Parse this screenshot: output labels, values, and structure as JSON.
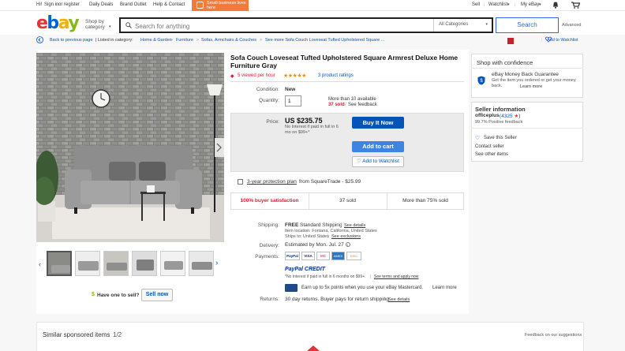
{
  "topbar": {
    "greeting": "Hi!",
    "sign_in": "Sign in",
    "or": "or",
    "register": "register",
    "daily_deals": "Daily Deals",
    "brand_outlet": "Brand Outlet",
    "help_contact": "Help & Contact",
    "promo_text": "Small business lives here",
    "sell": "Sell",
    "watchlist": "Watchlist",
    "my_ebay": "My eBay"
  },
  "header": {
    "logo": [
      "e",
      "b",
      "a",
      "y"
    ],
    "shop_by_category": "Shop by category",
    "search_placeholder": "Search for anything",
    "category_select": "All Categories",
    "search_button": "Search",
    "advanced": "Advanced"
  },
  "breadcrumb": {
    "back": "Back to previous page",
    "listed_in": "| Listed in category:",
    "items": [
      "Home & Garden",
      "Furniture",
      "Sofas, Armchairs & Couches",
      "See more Sofa Couch Loveseat Tufted Upholstered Square ..."
    ],
    "add_to_watchlist": "Add to Watchlist"
  },
  "listing": {
    "title": "Sofa Couch Loveseat Tufted Upholstered Square Armrest Deluxe Home Furniture Gray",
    "viewed": "5 viewed per hour",
    "ratings": "3 product ratings",
    "condition_label": "Condition:",
    "condition_value": "New",
    "quantity_label": "Quantity:",
    "quantity_value": "1",
    "available": "More than 10 available",
    "sold_link": "37 sold",
    "feedback_link": "See feedback",
    "price_label": "Price:",
    "price": "US $235.75",
    "interest": "No Interest if paid in full in 6 mo on $99+*",
    "buy_now": "Buy It Now",
    "add_to_cart": "Add to cart",
    "add_watchlist": "Add to Watchlist",
    "protection_link": "3-year protection plan",
    "protection_rest": "from SquareTrade - $25.99",
    "stat_satisfaction": "100% buyer satisfaction",
    "stat_sold": "37 sold",
    "stat_more": "More than 75% sold",
    "shipping_label": "Shipping:",
    "shipping_free": "FREE",
    "shipping_method": "Standard Shipping",
    "see_details": "See details",
    "item_location": "Item location: Fontana, California, United States",
    "ships_to": "Ships to: United States",
    "see_exclusions": "See exclusions",
    "delivery_label": "Delivery:",
    "delivery_value": "Estimated by Mon. Jul. 27",
    "payments_label": "Payments:",
    "payment_icons": [
      "PayPal",
      "VISA",
      "MC",
      "AMEX",
      "DISC"
    ],
    "paypal_credit": "PayPal CREDIT",
    "paypal_credit_terms": "*No Interest if paid in full in 6 months on $99+.",
    "see_terms": "See terms and apply now",
    "mastercard_text": "Earn up to 5x points when you use your eBay Mastercard.",
    "learn_more": "Learn more",
    "returns_label": "Returns:",
    "returns_value": "30 day returns. Buyer pays for return shipping",
    "have_one": "Have one to sell?",
    "sell_now": "Sell now"
  },
  "confidence": {
    "title": "Shop with confidence",
    "guarantee": "eBay Money Back Guarantee",
    "guarantee_text": "Get the item you ordered or get your money back.",
    "learn_more": "Learn more"
  },
  "seller": {
    "title": "Seller information",
    "name": "officeplus",
    "score": "(4325",
    "positive": "99.7% Positive feedback",
    "save": "Save this Seller",
    "contact": "Contact seller",
    "other_items": "See other items"
  },
  "sponsored": {
    "title": "Similar sponsored items",
    "page": "1/2",
    "feedback": "Feedback on our suggestions"
  },
  "colors": {
    "ebay_red": "#e53238",
    "ebay_blue": "#0064d2",
    "button_blue": "#0654ba",
    "sold_red": "#dd1e31",
    "star_orange": "#f18e00"
  }
}
